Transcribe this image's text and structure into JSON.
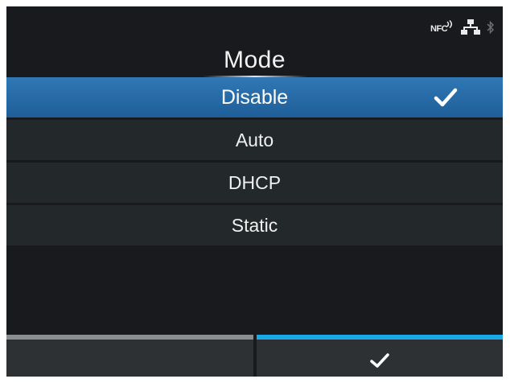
{
  "status_bar": {
    "nfc_label": "NFC",
    "icons": [
      "nfc-icon",
      "lan-icon",
      "bluetooth-icon"
    ]
  },
  "header": {
    "title": "Mode"
  },
  "options": [
    {
      "label": "Disable",
      "selected": true
    },
    {
      "label": "Auto",
      "selected": false
    },
    {
      "label": "DHCP",
      "selected": false
    },
    {
      "label": "Static",
      "selected": false
    }
  ],
  "softkeys": {
    "left": {
      "icon": "none"
    },
    "right": {
      "icon": "check-icon"
    }
  },
  "colors": {
    "selected_row": "#2a6ead",
    "right_softkey_accent": "#19a8e8",
    "left_softkey_accent": "#8b8e90"
  }
}
